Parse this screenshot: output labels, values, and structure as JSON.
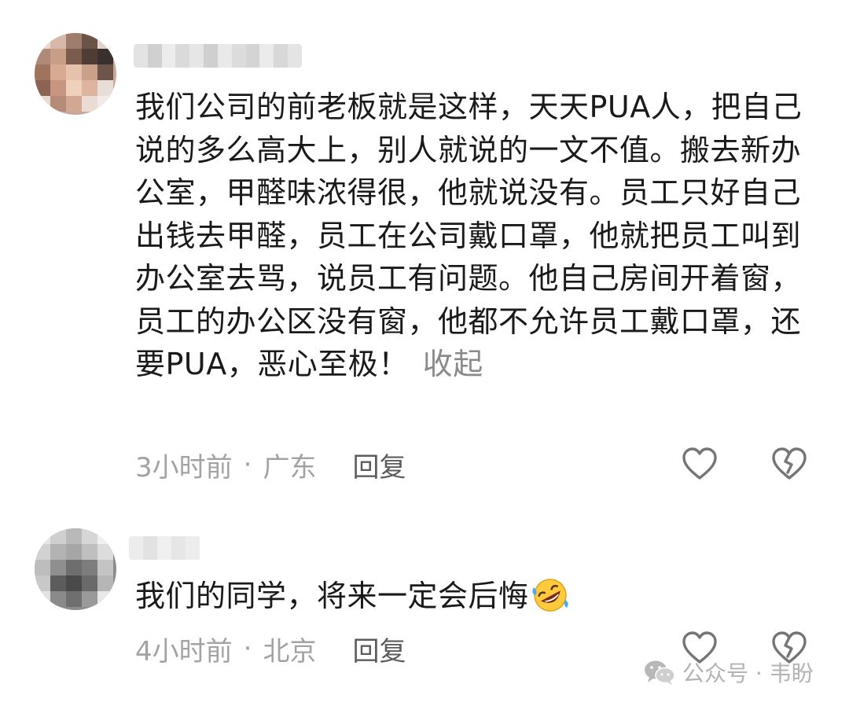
{
  "comments": [
    {
      "text": "我们公司的前老板就是这样，天天PUA人，把自己说的多么高大上，别人就说的一文不值。搬去新办公室，甲醛味浓得很，他就说没有。员工只好自己出钱去甲醛，员工在公司戴口罩，他就把员工叫到办公室去骂，说员工有问题。他自己房间开着窗，员工的办公区没有窗，他都不允许员工戴口罩，还要PUA，恶心至极！",
      "collapse_label": "收起",
      "time": "3小时前",
      "separator": "·",
      "location": "广东",
      "reply_label": "回复",
      "like_icon": "heart-outline-icon",
      "dislike_icon": "broken-heart-icon"
    },
    {
      "text": "我们的同学，将来一定会后悔",
      "emoji": "rolling-on-floor-laughing-emoji",
      "time": "4小时前",
      "separator": "·",
      "location": "北京",
      "reply_label": "回复",
      "like_icon": "heart-outline-icon",
      "dislike_icon": "broken-heart-icon"
    }
  ],
  "watermark": {
    "icon": "wechat-icon",
    "text": "公众号 · 韦盼"
  },
  "colors": {
    "text": "#1a1a1a",
    "meta": "#a3a3a3",
    "reply": "#5c5c5c",
    "icon_stroke": "#757575"
  }
}
